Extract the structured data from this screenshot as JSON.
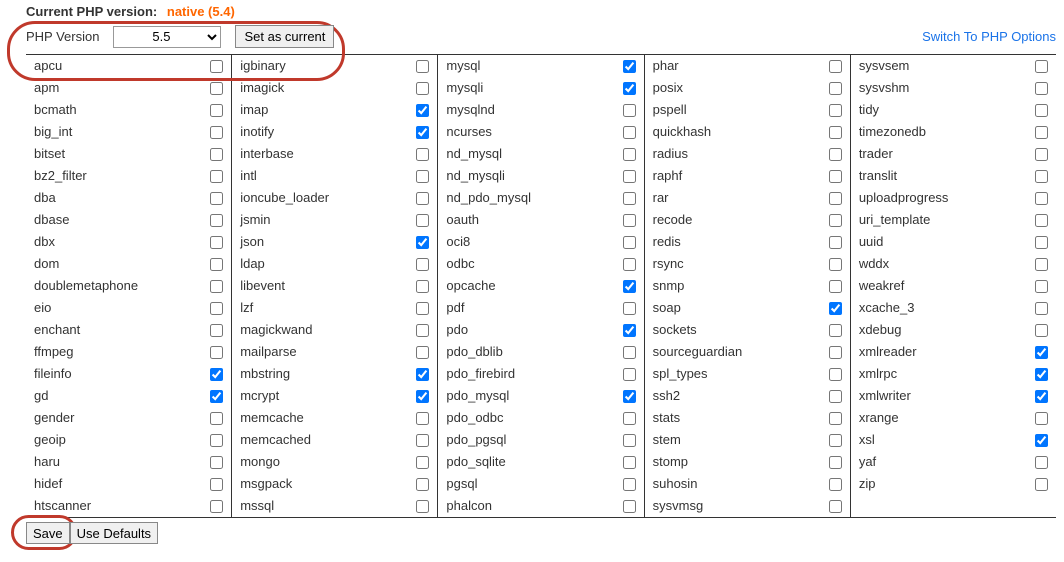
{
  "header": {
    "current_label": "Current PHP version:",
    "current_value": "native (5.4)"
  },
  "controls": {
    "php_version_label": "PHP Version",
    "selected_version": "5.5",
    "set_current_btn": "Set as current",
    "switch_link": "Switch To PHP Options"
  },
  "footer": {
    "save_btn": "Save",
    "defaults_btn": "Use Defaults"
  },
  "columns": [
    [
      {
        "name": "apcu",
        "checked": false
      },
      {
        "name": "apm",
        "checked": false
      },
      {
        "name": "bcmath",
        "checked": false
      },
      {
        "name": "big_int",
        "checked": false
      },
      {
        "name": "bitset",
        "checked": false
      },
      {
        "name": "bz2_filter",
        "checked": false
      },
      {
        "name": "dba",
        "checked": false
      },
      {
        "name": "dbase",
        "checked": false
      },
      {
        "name": "dbx",
        "checked": false
      },
      {
        "name": "dom",
        "checked": false
      },
      {
        "name": "doublemetaphone",
        "checked": false
      },
      {
        "name": "eio",
        "checked": false
      },
      {
        "name": "enchant",
        "checked": false
      },
      {
        "name": "ffmpeg",
        "checked": false
      },
      {
        "name": "fileinfo",
        "checked": true
      },
      {
        "name": "gd",
        "checked": true
      },
      {
        "name": "gender",
        "checked": false
      },
      {
        "name": "geoip",
        "checked": false
      },
      {
        "name": "haru",
        "checked": false
      },
      {
        "name": "hidef",
        "checked": false
      },
      {
        "name": "htscanner",
        "checked": false
      }
    ],
    [
      {
        "name": "igbinary",
        "checked": false
      },
      {
        "name": "imagick",
        "checked": false
      },
      {
        "name": "imap",
        "checked": true
      },
      {
        "name": "inotify",
        "checked": true
      },
      {
        "name": "interbase",
        "checked": false
      },
      {
        "name": "intl",
        "checked": false
      },
      {
        "name": "ioncube_loader",
        "checked": false
      },
      {
        "name": "jsmin",
        "checked": false
      },
      {
        "name": "json",
        "checked": true
      },
      {
        "name": "ldap",
        "checked": false
      },
      {
        "name": "libevent",
        "checked": false
      },
      {
        "name": "lzf",
        "checked": false
      },
      {
        "name": "magickwand",
        "checked": false
      },
      {
        "name": "mailparse",
        "checked": false
      },
      {
        "name": "mbstring",
        "checked": true
      },
      {
        "name": "mcrypt",
        "checked": true
      },
      {
        "name": "memcache",
        "checked": false
      },
      {
        "name": "memcached",
        "checked": false
      },
      {
        "name": "mongo",
        "checked": false
      },
      {
        "name": "msgpack",
        "checked": false
      },
      {
        "name": "mssql",
        "checked": false
      }
    ],
    [
      {
        "name": "mysql",
        "checked": true
      },
      {
        "name": "mysqli",
        "checked": true
      },
      {
        "name": "mysqlnd",
        "checked": false
      },
      {
        "name": "ncurses",
        "checked": false
      },
      {
        "name": "nd_mysql",
        "checked": false
      },
      {
        "name": "nd_mysqli",
        "checked": false
      },
      {
        "name": "nd_pdo_mysql",
        "checked": false
      },
      {
        "name": "oauth",
        "checked": false
      },
      {
        "name": "oci8",
        "checked": false
      },
      {
        "name": "odbc",
        "checked": false
      },
      {
        "name": "opcache",
        "checked": true
      },
      {
        "name": "pdf",
        "checked": false
      },
      {
        "name": "pdo",
        "checked": true
      },
      {
        "name": "pdo_dblib",
        "checked": false
      },
      {
        "name": "pdo_firebird",
        "checked": false
      },
      {
        "name": "pdo_mysql",
        "checked": true
      },
      {
        "name": "pdo_odbc",
        "checked": false
      },
      {
        "name": "pdo_pgsql",
        "checked": false
      },
      {
        "name": "pdo_sqlite",
        "checked": false
      },
      {
        "name": "pgsql",
        "checked": false
      },
      {
        "name": "phalcon",
        "checked": false
      }
    ],
    [
      {
        "name": "phar",
        "checked": false
      },
      {
        "name": "posix",
        "checked": false
      },
      {
        "name": "pspell",
        "checked": false
      },
      {
        "name": "quickhash",
        "checked": false
      },
      {
        "name": "radius",
        "checked": false
      },
      {
        "name": "raphf",
        "checked": false
      },
      {
        "name": "rar",
        "checked": false
      },
      {
        "name": "recode",
        "checked": false
      },
      {
        "name": "redis",
        "checked": false
      },
      {
        "name": "rsync",
        "checked": false
      },
      {
        "name": "snmp",
        "checked": false
      },
      {
        "name": "soap",
        "checked": true
      },
      {
        "name": "sockets",
        "checked": false
      },
      {
        "name": "sourceguardian",
        "checked": false
      },
      {
        "name": "spl_types",
        "checked": false
      },
      {
        "name": "ssh2",
        "checked": false
      },
      {
        "name": "stats",
        "checked": false
      },
      {
        "name": "stem",
        "checked": false
      },
      {
        "name": "stomp",
        "checked": false
      },
      {
        "name": "suhosin",
        "checked": false
      },
      {
        "name": "sysvmsg",
        "checked": false
      }
    ],
    [
      {
        "name": "sysvsem",
        "checked": false
      },
      {
        "name": "sysvshm",
        "checked": false
      },
      {
        "name": "tidy",
        "checked": false
      },
      {
        "name": "timezonedb",
        "checked": false
      },
      {
        "name": "trader",
        "checked": false
      },
      {
        "name": "translit",
        "checked": false
      },
      {
        "name": "uploadprogress",
        "checked": false
      },
      {
        "name": "uri_template",
        "checked": false
      },
      {
        "name": "uuid",
        "checked": false
      },
      {
        "name": "wddx",
        "checked": false
      },
      {
        "name": "weakref",
        "checked": false
      },
      {
        "name": "xcache_3",
        "checked": false
      },
      {
        "name": "xdebug",
        "checked": false
      },
      {
        "name": "xmlreader",
        "checked": true
      },
      {
        "name": "xmlrpc",
        "checked": true
      },
      {
        "name": "xmlwriter",
        "checked": true
      },
      {
        "name": "xrange",
        "checked": false
      },
      {
        "name": "xsl",
        "checked": true
      },
      {
        "name": "yaf",
        "checked": false
      },
      {
        "name": "zip",
        "checked": false
      }
    ]
  ]
}
